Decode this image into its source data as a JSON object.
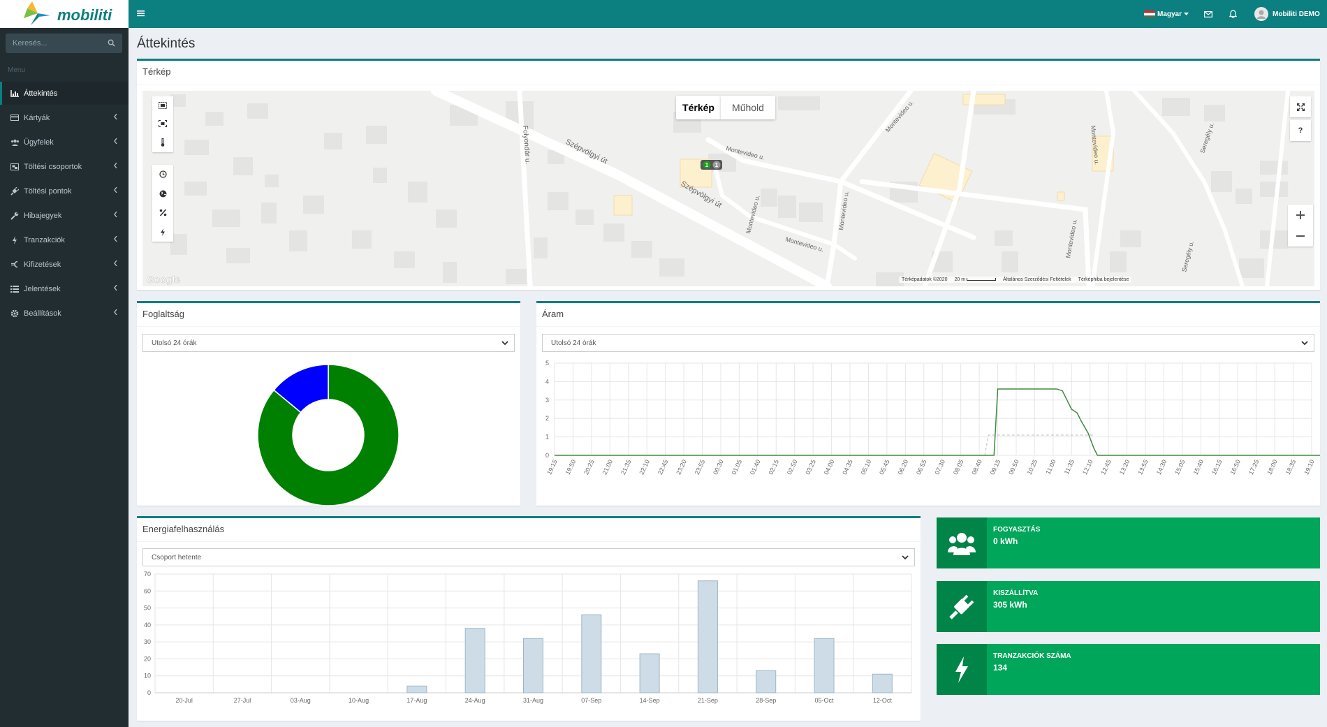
{
  "app": {
    "brand": "mobiliti",
    "page_title": "Áttekintés"
  },
  "search": {
    "placeholder": "Keresés..."
  },
  "sidebar": {
    "header": "Menu",
    "items": [
      {
        "label": "Áttekintés",
        "icon": "bar-chart-icon",
        "active": true
      },
      {
        "label": "Kártyák",
        "icon": "card-icon"
      },
      {
        "label": "Ügyfelek",
        "icon": "users-icon"
      },
      {
        "label": "Töltési csoportok",
        "icon": "object-group-icon"
      },
      {
        "label": "Töltési pontok",
        "icon": "plug-icon"
      },
      {
        "label": "Hibajegyek",
        "icon": "wrench-icon"
      },
      {
        "label": "Tranzakciók",
        "icon": "bolt-icon"
      },
      {
        "label": "Kifizetések",
        "icon": "euro-icon"
      },
      {
        "label": "Jelentések",
        "icon": "list-icon"
      },
      {
        "label": "Beállítások",
        "icon": "gear-icon"
      }
    ]
  },
  "topbar": {
    "language": "Magyar",
    "user": "Mobiliti DEMO"
  },
  "map_box": {
    "title": "Térkép",
    "tabs": [
      "Térkép",
      "Műhold"
    ],
    "street_labels": [
      "Szépvölgyi út",
      "Szépvölgyi út",
      "Folyondár u.",
      "Montevideo u.",
      "Montevideo u.",
      "Montevideo u.",
      "Montevideo u.",
      "Montevideo u.",
      "Montevideo u.",
      "Montevideo u.",
      "Seregély u.",
      "Seregély u."
    ],
    "markers": [
      "1",
      "1"
    ],
    "help_button": "?",
    "google": "Google",
    "attribution": {
      "data": "Térképadatok ©2020",
      "scale": "20 m",
      "terms": "Általános Szerződési Feltételek",
      "report": "Térképhiba bejelentése"
    }
  },
  "occupancy": {
    "title": "Foglaltság",
    "period": "Utolsó 24 órák"
  },
  "current": {
    "title": "Áram",
    "period": "Utolsó 24 órák"
  },
  "energy": {
    "title": "Energiafelhasználás",
    "group": "Csoport hetente"
  },
  "info_boxes": [
    {
      "label": "Fogyasztás",
      "value": "0 kWh",
      "icon": "users-icon"
    },
    {
      "label": "Kiszállítva",
      "value": "305 kWh",
      "icon": "plug-icon"
    },
    {
      "label": "Tranzakciók száma",
      "value": "134",
      "icon": "bolt-icon"
    }
  ],
  "colors": {
    "teal": "#0c7f80",
    "sidebar": "#222d32",
    "green": "#00a65a",
    "donut_green": "#008000",
    "donut_blue": "#0000ff",
    "bar_fill": "#cddce6",
    "bar_stroke": "#9fb6c6",
    "line": "#3d8c3d"
  },
  "chart_data": [
    {
      "type": "pie",
      "name": "Foglaltság",
      "donut": true,
      "slices": [
        {
          "value": 86,
          "color": "#008000"
        },
        {
          "value": 14,
          "color": "#0000ff"
        }
      ]
    },
    {
      "type": "line",
      "name": "Áram",
      "ylim": [
        0,
        5
      ],
      "yticks": [
        0,
        1,
        2,
        3,
        4,
        5
      ],
      "categories": [
        "19:15",
        "19:50",
        "20:25",
        "21:00",
        "21:35",
        "22:10",
        "22:45",
        "23:20",
        "23:55",
        "00:30",
        "01:05",
        "01:40",
        "02:15",
        "02:50",
        "03:25",
        "04:00",
        "04:35",
        "05:10",
        "05:45",
        "06:20",
        "06:55",
        "07:30",
        "08:05",
        "08:40",
        "09:15",
        "09:50",
        "10:25",
        "11:00",
        "11:35",
        "12:10",
        "12:45",
        "13:20",
        "13:55",
        "14:30",
        "15:05",
        "15:40",
        "16:15",
        "16:50",
        "17:25",
        "18:00",
        "18:35",
        "19:10"
      ],
      "series": [
        {
          "x": [
            0,
            23.3,
            23.8,
            24.0,
            24.3,
            27.2,
            27.5,
            27.7,
            28.0,
            28.3,
            28.5,
            28.9,
            29.2,
            29.4,
            42
          ],
          "y": [
            0,
            0,
            0,
            3.6,
            3.6,
            3.6,
            3.5,
            3.1,
            2.5,
            2.3,
            1.9,
            1.2,
            0.4,
            0,
            0
          ]
        }
      ],
      "dashed_series": {
        "x": [
          23.3,
          23.5,
          29.2
        ],
        "y": [
          0,
          1.1,
          1.1
        ]
      }
    },
    {
      "type": "bar",
      "name": "Energiafelhasználás",
      "ylim": [
        0,
        70
      ],
      "yticks": [
        0,
        10,
        20,
        30,
        40,
        50,
        60,
        70
      ],
      "categories": [
        "20-Jul",
        "27-Jul",
        "03-Aug",
        "10-Aug",
        "17-Aug",
        "24-Aug",
        "31-Aug",
        "07-Sep",
        "14-Sep",
        "21-Sep",
        "28-Sep",
        "05-Oct",
        "12-Oct"
      ],
      "values": [
        0,
        0,
        0,
        0,
        4,
        38,
        32,
        46,
        23,
        66,
        13,
        32,
        11
      ]
    }
  ]
}
